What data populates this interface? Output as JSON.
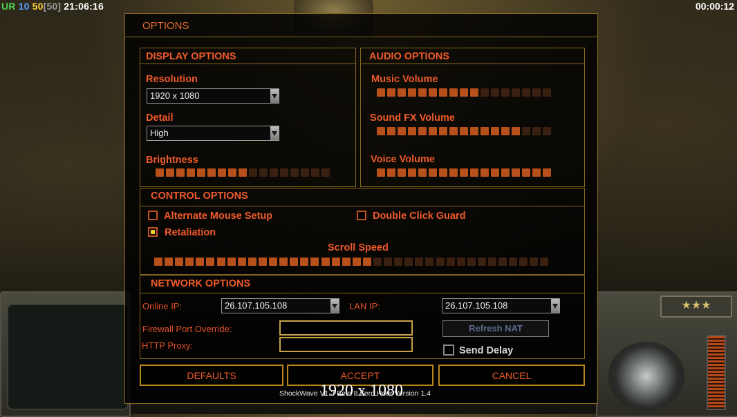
{
  "hud": {
    "ur": "UR",
    "n10": "10",
    "n50": "50",
    "n50b": "[50]",
    "clock": "21:06:16",
    "timer": "00:00:12"
  },
  "dialog": {
    "title": "OPTIONS",
    "display": {
      "header": "DISPLAY OPTIONS",
      "resolution_label": "Resolution",
      "resolution_value": "1920 x 1080",
      "detail_label": "Detail",
      "detail_value": "High",
      "brightness_label": "Brightness",
      "brightness_level": 0.5
    },
    "audio": {
      "header": "AUDIO OPTIONS",
      "music_label": "Music Volume",
      "music_level": 0.6,
      "sfx_label": "Sound FX Volume",
      "sfx_level": 0.85,
      "voice_label": "Voice Volume",
      "voice_level": 1.0
    },
    "control": {
      "header": "CONTROL OPTIONS",
      "alt_mouse_label": "Alternate Mouse Setup",
      "alt_mouse_checked": false,
      "double_click_label": "Double Click Guard",
      "double_click_checked": false,
      "retaliation_label": "Retaliation",
      "retaliation_checked": true,
      "scroll_label": "Scroll Speed",
      "scroll_level": 0.55
    },
    "network": {
      "header": "NETWORK OPTIONS",
      "online_ip_label": "Online IP:",
      "online_ip_value": "26.107.105.108",
      "lan_ip_label": "LAN IP:",
      "lan_ip_value": "26.107.105.108",
      "firewall_label": "Firewall Port Override:",
      "firewall_value": "",
      "proxy_label": "HTTP Proxy:",
      "proxy_value": "",
      "refresh_nat": "Refresh NAT",
      "send_delay_label": "Send Delay",
      "send_delay_checked": false
    },
    "buttons": {
      "defaults": "DEFAULTS",
      "accept": "ACCEPT",
      "cancel": "CANCEL"
    },
    "footer": "ShockWave V1.3 Beta 8 Zero Hour Version 1.4",
    "overlay_resolution": "1920 x 1080"
  },
  "colors": {
    "accent": "#ef5a2a",
    "frame": "#8a6a1e",
    "slider_on": "#b8501c",
    "slider_off": "#3a2010",
    "check_fill": "#ffcc22"
  }
}
